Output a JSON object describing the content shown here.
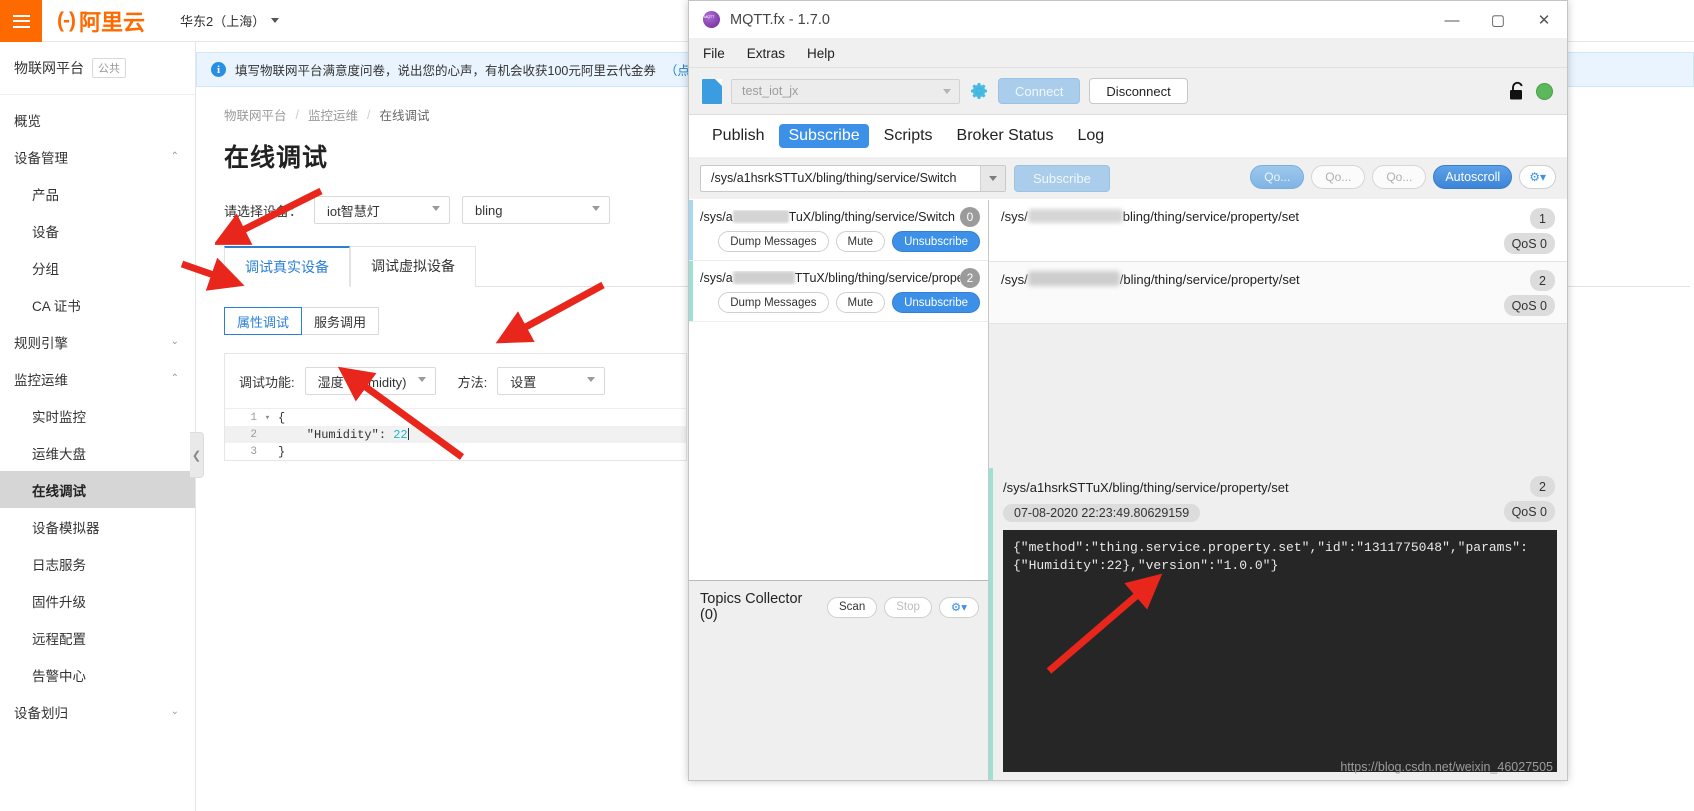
{
  "aliyun": {
    "topbar": {
      "logo_cn": "阿里云",
      "region": "华东2（上海）"
    },
    "sidebar": {
      "product": "物联网平台",
      "product_tag": "公共",
      "items": [
        {
          "label": "概览",
          "level": 1,
          "chev": ""
        },
        {
          "label": "设备管理",
          "level": 1,
          "chev": "up"
        },
        {
          "label": "产品",
          "level": 2,
          "chev": ""
        },
        {
          "label": "设备",
          "level": 2,
          "chev": ""
        },
        {
          "label": "分组",
          "level": 2,
          "chev": ""
        },
        {
          "label": "CA 证书",
          "level": 2,
          "chev": ""
        },
        {
          "label": "规则引擎",
          "level": 1,
          "chev": "down"
        },
        {
          "label": "监控运维",
          "level": 1,
          "chev": "up"
        },
        {
          "label": "实时监控",
          "level": 2,
          "chev": ""
        },
        {
          "label": "运维大盘",
          "level": 2,
          "chev": ""
        },
        {
          "label": "在线调试",
          "level": 2,
          "chev": "",
          "active": true
        },
        {
          "label": "设备模拟器",
          "level": 2,
          "chev": ""
        },
        {
          "label": "日志服务",
          "level": 2,
          "chev": ""
        },
        {
          "label": "固件升级",
          "level": 2,
          "chev": ""
        },
        {
          "label": "远程配置",
          "level": 2,
          "chev": ""
        },
        {
          "label": "告警中心",
          "level": 2,
          "chev": ""
        },
        {
          "label": "设备划归",
          "level": 1,
          "chev": "down"
        }
      ]
    },
    "notice": {
      "text": "填写物联网平台满意度问卷，说出您的心声，有机会收获100元阿里云代金券",
      "link": "（点击进入）"
    },
    "breadcrumb": {
      "b1": "物联网平台",
      "b2": "监控运维",
      "b3": "在线调试",
      "sep": "/"
    },
    "page_title": "在线调试",
    "device_row": {
      "label": "请选择设备：",
      "product_value": "iot智慧灯",
      "device_value": "bling"
    },
    "tabs": [
      {
        "label": "调试真实设备",
        "active": true
      },
      {
        "label": "调试虚拟设备",
        "active": false
      }
    ],
    "segments": [
      {
        "label": "属性调试",
        "active": true
      },
      {
        "label": "服务调用",
        "active": false
      }
    ],
    "debug_panel": {
      "func_label": "调试功能:",
      "func_value": "湿度 (Humidity)",
      "method_label": "方法:",
      "method_value": "设置"
    },
    "editor": {
      "lines": [
        {
          "no": "1",
          "fold": "▾",
          "text": "{"
        },
        {
          "no": "2",
          "fold": "",
          "text": "    \"Humidity\": ",
          "num": "22",
          "highlight": true
        },
        {
          "no": "3",
          "fold": "",
          "text": "}"
        }
      ]
    }
  },
  "mqtt": {
    "title": "MQTT.fx - 1.7.0",
    "window_buttons": {
      "minimize": "—",
      "maximize": "▢",
      "close": "✕"
    },
    "menu": [
      "File",
      "Extras",
      "Help"
    ],
    "connection": {
      "profile_placeholder": "test_iot_jx",
      "connect_label": "Connect",
      "disconnect_label": "Disconnect"
    },
    "tabs": [
      {
        "label": "Publish",
        "active": false
      },
      {
        "label": "Subscribe",
        "active": true
      },
      {
        "label": "Scripts",
        "active": false
      },
      {
        "label": "Broker Status",
        "active": false
      },
      {
        "label": "Log",
        "active": false
      }
    ],
    "subscribe_bar": {
      "topic_value": "/sys/a1hsrkSTTuX/bling/thing/service/Switch",
      "subscribe_label": "Subscribe",
      "qos_labels": [
        "Qo...",
        "Qo...",
        "Qo..."
      ],
      "autoscroll_label": "Autoscroll",
      "config_label": "⚙▾"
    },
    "subscriptions": [
      {
        "prefix": "/sys/a",
        "suffix": "TuX/bling/thing/service/Switch",
        "count": "0",
        "buttons": [
          "Dump Messages",
          "Mute",
          "Unsubscribe"
        ]
      },
      {
        "prefix": "/sys/a",
        "suffix": "TTuX/bling/thing/service/proper",
        "count": "2",
        "buttons": [
          "Dump Messages",
          "Mute",
          "Unsubscribe"
        ]
      }
    ],
    "topics_collector": {
      "title": "Topics Collector (0)",
      "scan_label": "Scan",
      "stop_label": "Stop",
      "config_label": "⚙▾"
    },
    "messages": [
      {
        "prefix": "/sys/",
        "suffix": "bling/thing/service/property/set",
        "num": "1",
        "qos": "QoS 0"
      },
      {
        "prefix": "/sys/",
        "suffix": "/bling/thing/service/property/set",
        "num": "2",
        "qos": "QoS 0"
      }
    ],
    "detail": {
      "topic": "/sys/a1hsrkSTTuX/bling/thing/service/property/set",
      "num": "2",
      "qos": "QoS 0",
      "timestamp": "07-08-2020  22:23:49.80629159",
      "payload": "{\"method\":\"thing.service.property.set\",\"id\":\"1311775048\",\"params\":{\"Humidity\":22},\"version\":\"1.0.0\"}"
    },
    "watermark": "https://blog.csdn.net/weixin_46027505"
  },
  "colors": {
    "brand_orange": "#ff6a00",
    "accent_blue": "#2a7fd4",
    "mqtt_blue": "#3c90e8",
    "annotation_red": "#e8261c"
  }
}
